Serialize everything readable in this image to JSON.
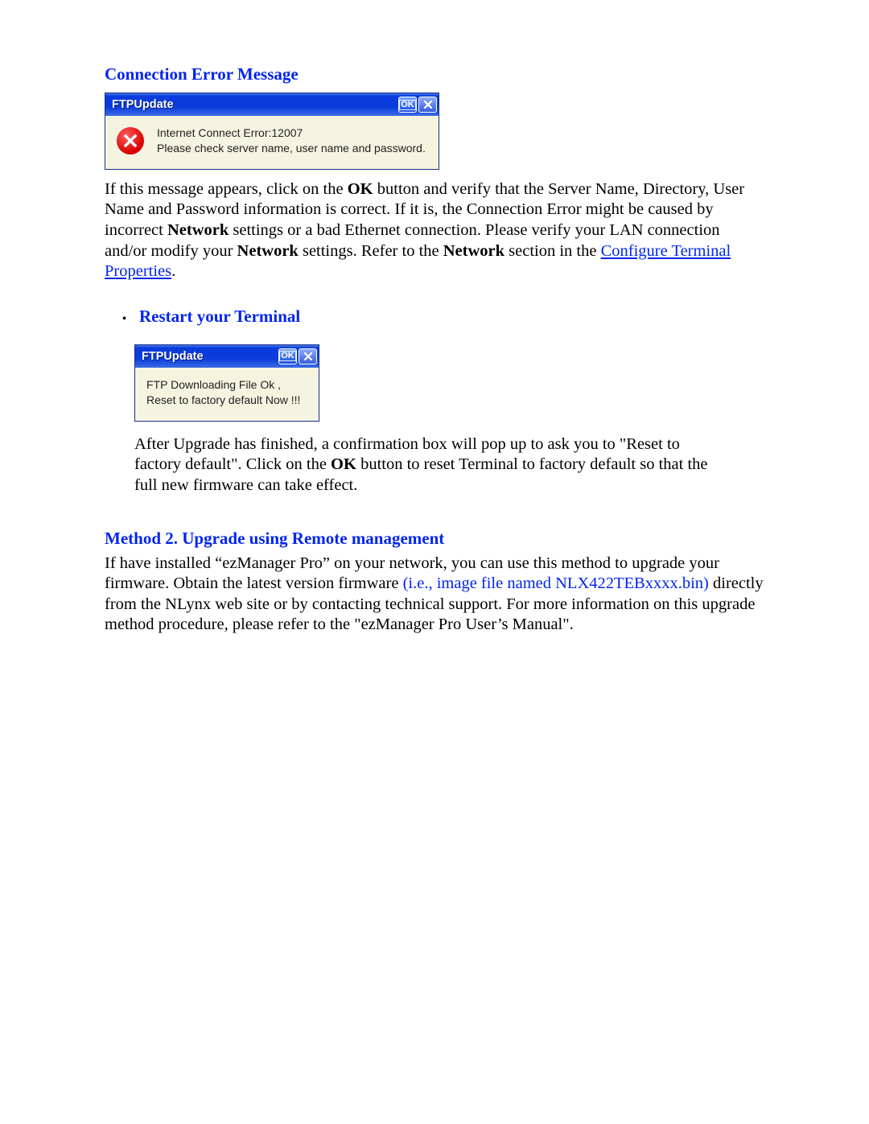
{
  "section1": {
    "title": "Connection Error Message"
  },
  "dialog1": {
    "title": "FTPUpdate",
    "ok": "OK",
    "msg": "Internet Connect Error:12007\nPlease check server name, user name and password."
  },
  "para1": {
    "t1": "If this message appears, click on the ",
    "b1": "OK",
    "t2": " button and verify that the Server Name, Directory, User Name and Password information is correct.  If it is, the Connection Error might be caused by incorrect ",
    "b2": "Network",
    "t3": " settings or a bad Ethernet connection.  Please verify your LAN connection and/or modify your ",
    "b3": "Network",
    "t4": " settings.  Refer to the ",
    "b4": "Network",
    "t5": " section in the ",
    "link": "Configure Terminal Properties",
    "t6": "."
  },
  "bullet": {
    "title": "Restart your Terminal"
  },
  "dialog2": {
    "title": "FTPUpdate",
    "ok": "OK",
    "msg": "FTP Downloading File Ok ,\nReset to factory default Now !!!"
  },
  "para2": {
    "t1": "After Upgrade has finished, a confirmation box will pop up to ask you to \"Reset to factory default\". Click on the ",
    "b1": "OK",
    "t2": " button to reset Terminal to factory default so that the full new firmware can take effect."
  },
  "method2": {
    "title": "Method 2.  Upgrade using Remote management"
  },
  "para3": {
    "t1": "If have installed “ezManager Pro” on your network, you can use this method to upgrade your firmware.  Obtain the latest version firmware ",
    "blue": "(i.e., image file named NLX422TEBxxxx.bin)",
    "t2": " directly from the NLynx web site or by contacting technical support.  For more information on this upgrade method procedure, please refer to the \"ezManager Pro User’s Manual\"."
  }
}
